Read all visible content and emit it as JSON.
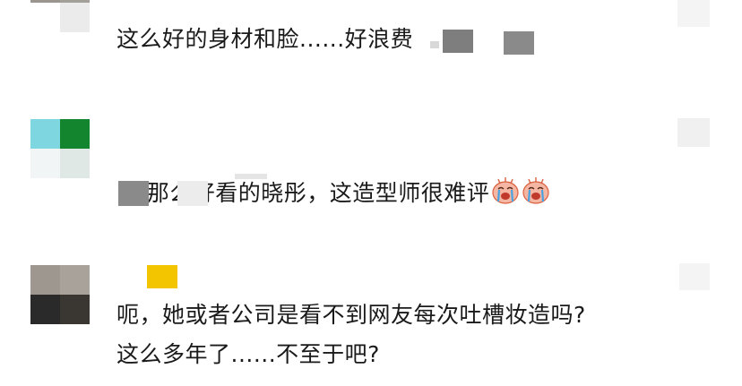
{
  "comments": [
    {
      "text": "这么好的身材和脸......好浪费",
      "avatar_colors": [
        "#9a958e",
        "#c9c6c1",
        "#ffffff",
        "#ebebeb"
      ]
    },
    {
      "text": "那么好看的晓彤，这造型师很难评",
      "avatar_colors": [
        "#7dd6e0",
        "#13852e",
        "#f1f5f5",
        "#dfe8e4"
      ],
      "emoji": "loudly-crying-face"
    },
    {
      "text_line1": "呃，她或者公司是看不到网友每次吐槽妆造吗?",
      "text_line2": "这么多年了......不至于吧?",
      "avatar_colors": [
        "#9d9790",
        "#4a4640",
        "#2a2a2a",
        "#5b544e"
      ]
    }
  ],
  "colors": {
    "text": "#1a1a1a",
    "highlight_badge": "#f2c500"
  }
}
